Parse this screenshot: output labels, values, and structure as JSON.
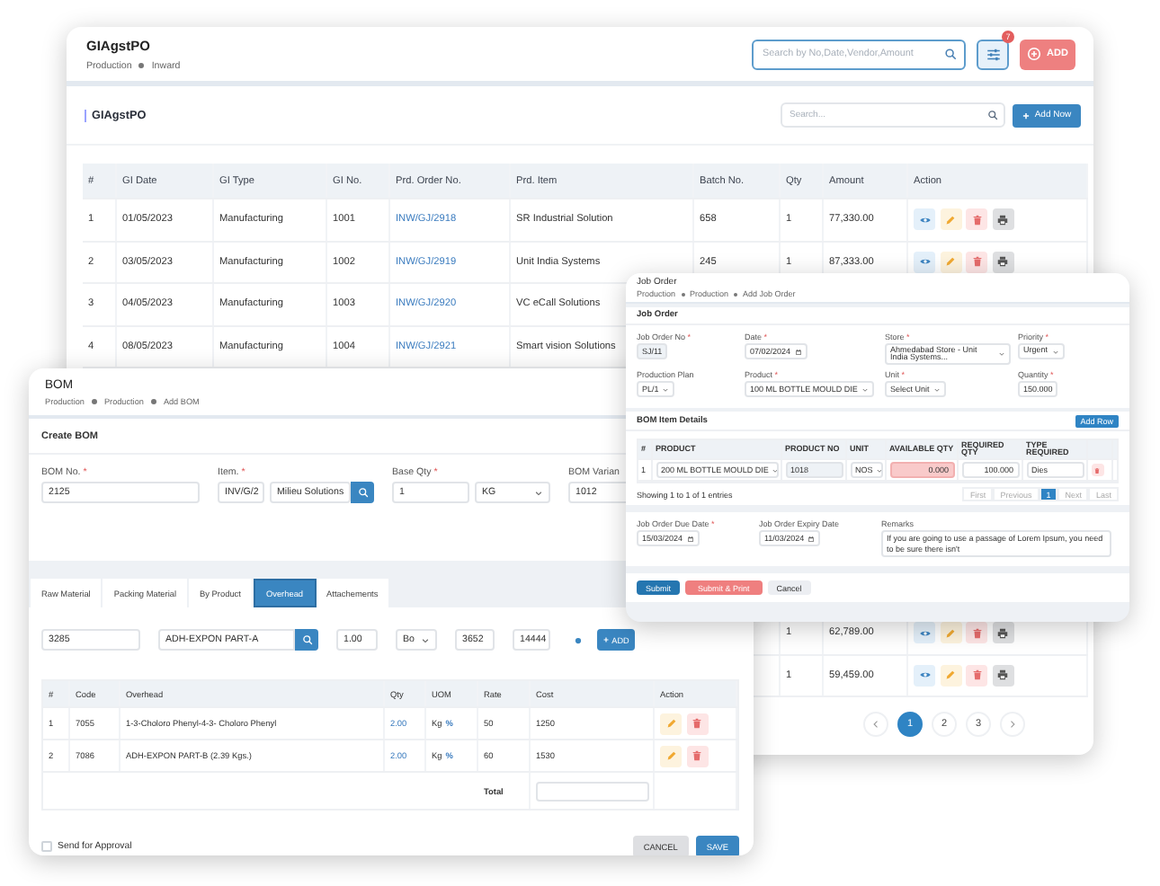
{
  "main_window": {
    "title": "GIAgstPO",
    "breadcrumb": [
      "Production",
      "Inward"
    ],
    "search": {
      "placeholder": "Search by No,Date,Vendor,Amount"
    },
    "filter_badge": "7",
    "add_button": "ADD",
    "card": {
      "title": "GIAgstPO",
      "search": {
        "placeholder": "Search..."
      },
      "add_button": "Add Now"
    },
    "table": {
      "columns": [
        {
          "label": "#",
          "kind": "text"
        },
        {
          "label": "GI Date",
          "kind": "text"
        },
        {
          "label": "GI Type",
          "kind": "text"
        },
        {
          "label": "GI No.",
          "kind": "text"
        },
        {
          "label": "Prd. Order No.",
          "kind": "link"
        },
        {
          "label": "Prd. Item",
          "kind": "text"
        },
        {
          "label": "Batch No.",
          "kind": "text"
        },
        {
          "label": "Qty",
          "kind": "text"
        },
        {
          "label": "Amount",
          "kind": "text"
        },
        {
          "label": "Action",
          "kind": "actions"
        }
      ],
      "rows": [
        {
          "cells": [
            "1",
            "01/05/2023",
            "Manufacturing",
            "1001",
            "INW/GJ/2918",
            "SR Industrial Solution",
            "658",
            "1",
            "77,330.00"
          ],
          "actions": [
            {
              "kind": "view"
            },
            {
              "kind": "edit"
            },
            {
              "kind": "delete"
            },
            {
              "kind": "print"
            }
          ]
        },
        {
          "cells": [
            "2",
            "03/05/2023",
            "Manufacturing",
            "1002",
            "INW/GJ/2919",
            "Unit India Systems",
            "245",
            "1",
            "87,333.00"
          ],
          "actions": [
            {
              "kind": "view"
            },
            {
              "kind": "edit"
            },
            {
              "kind": "delete"
            },
            {
              "kind": "print"
            }
          ]
        },
        {
          "cells": [
            "3",
            "04/05/2023",
            "Manufacturing",
            "1003",
            "INW/GJ/2920",
            "VC eCall Solutions"
          ]
        },
        {
          "cells": [
            "4",
            "08/05/2023",
            "Manufacturing",
            "1004",
            "INW/GJ/2921",
            "Smart vision Solutions"
          ]
        }
      ],
      "lower_rows": [
        {
          "qty": "1",
          "amount": "62,789.00",
          "actions": [
            {
              "kind": "view"
            },
            {
              "kind": "edit"
            },
            {
              "kind": "delete"
            },
            {
              "kind": "print"
            }
          ]
        },
        {
          "qty": "1",
          "amount": "59,459.00",
          "actions": [
            {
              "kind": "view"
            },
            {
              "kind": "edit"
            },
            {
              "kind": "delete"
            },
            {
              "kind": "print"
            }
          ]
        }
      ]
    },
    "pagination": [
      {
        "kind": "prev"
      },
      {
        "kind": "page",
        "label": "1",
        "selected": true
      },
      {
        "kind": "page",
        "label": "2",
        "selected": false
      },
      {
        "kind": "page",
        "label": "3",
        "selected": false
      },
      {
        "kind": "next"
      }
    ]
  },
  "bom_window": {
    "title": "BOM",
    "breadcrumb": [
      "Production",
      "Production",
      "Add BOM"
    ],
    "section_title": "Create BOM",
    "fields": [
      {
        "kind": "text",
        "label": "BOM No.",
        "marker": "*",
        "value": "2125"
      },
      {
        "kind": "lookup",
        "label": "Item.",
        "marker": "*",
        "code": "INV/G/2",
        "value": "Milieu Solutions"
      },
      {
        "kind": "quantity",
        "label": "Base Qty",
        "marker": "*",
        "value": "1",
        "unit": "KG"
      },
      {
        "kind": "text",
        "label": "BOM Varian",
        "value": "1012"
      }
    ],
    "tabs": [
      {
        "label": "Raw Material",
        "selected": false
      },
      {
        "label": "Packing Material",
        "selected": false
      },
      {
        "label": "By Product",
        "selected": false
      },
      {
        "label": "Overhead",
        "selected": true
      },
      {
        "label": "Attachements",
        "selected": false
      }
    ],
    "entry_row": {
      "code": "3285",
      "item": "ADH-EXPON PART-A",
      "qty": "1.00",
      "unit": "Bo",
      "rate": "3652",
      "cost": "14444",
      "add_button": "ADD"
    },
    "table": {
      "columns": [
        {
          "label": "#",
          "kind": "text"
        },
        {
          "label": "Code",
          "kind": "text"
        },
        {
          "label": "Overhead",
          "kind": "text"
        },
        {
          "label": "Qty",
          "kind": "link"
        },
        {
          "label": "UOM",
          "kind": "uom"
        },
        {
          "label": "Rate",
          "kind": "text"
        },
        {
          "label": "Cost",
          "kind": "text"
        },
        {
          "label": "Action",
          "kind": "actions"
        }
      ],
      "rows": [
        {
          "cells": [
            "1",
            "7055",
            "1-3-Choloro Phenyl-4-3- Choloro Phenyl",
            "2.00",
            "Kg",
            "50",
            "1250"
          ],
          "uom_mark": "%",
          "actions": [
            {
              "kind": "edit"
            },
            {
              "kind": "delete"
            }
          ]
        },
        {
          "cells": [
            "2",
            "7086",
            "ADH-EXPON PART-B (2.39 Kgs.)",
            "2.00",
            "Kg",
            "60",
            "1530"
          ],
          "uom_mark": "%",
          "actions": [
            {
              "kind": "edit"
            },
            {
              "kind": "delete"
            }
          ]
        }
      ],
      "total_label": "Total"
    },
    "approval": {
      "label": "Send for Approval",
      "checked": false
    },
    "buttons": [
      {
        "label": "CANCEL",
        "kind": "secondary"
      },
      {
        "label": "SAVE",
        "kind": "primary"
      }
    ]
  },
  "job_window": {
    "title": "Job Order",
    "breadcrumb": [
      "Production",
      "Production",
      "Add Job Order"
    ],
    "section_title": "Job Order",
    "fields": [
      {
        "kind": "readonly",
        "label": "Job Order No",
        "marker": "*",
        "value": "SJ/11"
      },
      {
        "kind": "date",
        "label": "Date",
        "marker": "*",
        "value": "07/02/2024"
      },
      {
        "kind": "select",
        "label": "Store",
        "marker": "*",
        "value": "Ahmedabad Store - Unit India Systems..."
      },
      {
        "kind": "select",
        "label": "Priority",
        "marker": "*",
        "value": "Urgent"
      },
      {
        "kind": "select",
        "label": "Production Plan",
        "value": "PL/1"
      },
      {
        "kind": "select",
        "label": "Product",
        "marker": "*",
        "value": "100 ML BOTTLE MOULD DIE"
      },
      {
        "kind": "select",
        "label": "Unit",
        "marker": "*",
        "value": "Select Unit"
      },
      {
        "kind": "number",
        "label": "Quantity",
        "marker": "*",
        "value": "150.000"
      }
    ],
    "items": {
      "title": "BOM Item Details",
      "add_button": "Add Row",
      "columns": [
        {
          "label": "#",
          "kind": "text"
        },
        {
          "label": "PRODUCT",
          "kind": "select"
        },
        {
          "label": "PRODUCT NO",
          "kind": "readonly"
        },
        {
          "label": "UNIT",
          "kind": "select"
        },
        {
          "label": "AVAILABLE QTY",
          "kind": "warning"
        },
        {
          "label": "REQUIRED QTY",
          "kind": "number"
        },
        {
          "label": "TYPE REQUIRED",
          "kind": "input"
        },
        {
          "kind": "actions"
        }
      ],
      "rows": [
        {
          "cells": [
            "1",
            "200 ML BOTTLE MOULD DIE",
            "1018",
            "NOS",
            "0.000",
            "100.000",
            "Dies"
          ],
          "actions": [
            {
              "kind": "delete"
            }
          ]
        }
      ],
      "info": "Showing 1 to 1 of 1 entries",
      "pagination": [
        {
          "kind": "nav",
          "label": "First",
          "selected": false
        },
        {
          "kind": "nav",
          "label": "Previous",
          "selected": false
        },
        {
          "kind": "page",
          "label": "1",
          "selected": true
        },
        {
          "kind": "nav",
          "label": "Next",
          "selected": false
        },
        {
          "kind": "nav",
          "label": "Last",
          "selected": false
        }
      ]
    },
    "dates": [
      {
        "kind": "date",
        "label": "Job Order Due Date",
        "marker": "*",
        "value": "15/03/2024"
      },
      {
        "kind": "date",
        "label": "Job Order Expiry Date",
        "value": "11/03/2024"
      },
      {
        "kind": "textarea",
        "label": "Remarks",
        "value": "If you are going to use a passage of Lorem Ipsum, you need to be sure there isn't"
      }
    ],
    "buttons": [
      {
        "label": "Submit",
        "kind": "primary"
      },
      {
        "label": "Submit & Print",
        "kind": "danger"
      },
      {
        "label": "Cancel",
        "kind": "secondary"
      }
    ]
  }
}
